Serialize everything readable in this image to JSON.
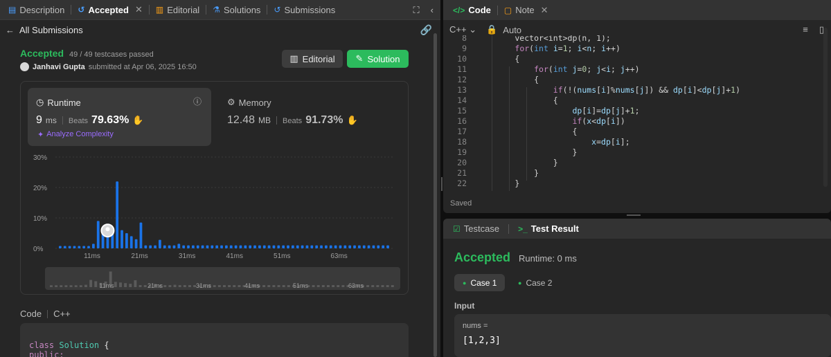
{
  "left_tabs": [
    {
      "label": "Description",
      "icon": "document-icon"
    },
    {
      "label": "Accepted",
      "icon": "history-icon"
    },
    {
      "label": "Editorial",
      "icon": "book-icon"
    },
    {
      "label": "Solutions",
      "icon": "flask-icon"
    },
    {
      "label": "Submissions",
      "icon": "history-icon"
    }
  ],
  "subheader": {
    "back_label": "All Submissions"
  },
  "submission": {
    "status": "Accepted",
    "testcases": "49 / 49 testcases passed",
    "author": "Janhavi Gupta",
    "submitted_text": "submitted at Apr 06, 2025 16:50",
    "editorial_btn": "Editorial",
    "solution_btn": "Solution"
  },
  "runtime": {
    "title": "Runtime",
    "value": "9",
    "unit": "ms",
    "beats_label": "Beats",
    "beats_pct": "79.63%",
    "analyze": "Analyze Complexity"
  },
  "memory": {
    "title": "Memory",
    "value": "12.48",
    "unit": "MB",
    "beats_label": "Beats",
    "beats_pct": "91.73%"
  },
  "chart_data": {
    "type": "bar",
    "yticks": [
      "30%",
      "20%",
      "10%",
      "0%"
    ],
    "ylim": [
      0,
      30
    ],
    "xticks": [
      "11ms",
      "21ms",
      "31ms",
      "41ms",
      "51ms",
      "63ms"
    ],
    "values": [
      0.8,
      0.8,
      0.8,
      0.8,
      0.8,
      0.8,
      0.8,
      1.5,
      9.0,
      7.0,
      4.5,
      6.5,
      22.0,
      6.0,
      5.0,
      4.0,
      3.0,
      8.5,
      1.0,
      1.0,
      1.0,
      2.8,
      1.0,
      1.0,
      1.0,
      1.5,
      1.0,
      1.0,
      1.0,
      1.0,
      1.0,
      1.0,
      1.0,
      1.0,
      1.0,
      1.0,
      1.0,
      1.0,
      1.0,
      1.0,
      1.0,
      1.0,
      1.0,
      1.0,
      1.0,
      1.0,
      1.0,
      1.0,
      1.0,
      1.0,
      1.0,
      1.0,
      1.0,
      1.0,
      1.0,
      1.0,
      1.0,
      1.0,
      1.0,
      1.0,
      1.0,
      1.0,
      1.0,
      1.0,
      1.0,
      1.0,
      1.0,
      1.0,
      1.0,
      1.0
    ],
    "highlight_index": 10,
    "bar_color": "#1a73e8",
    "overview_color": "#5a5a5a"
  },
  "code_section": {
    "label": "Code",
    "lang": "C++",
    "line1_kw": "class",
    "line1_name": "Solution",
    "line1_brace": "{",
    "line2": "public:"
  },
  "right_tabs": {
    "code": "Code",
    "note": "Note"
  },
  "editor": {
    "language": "C++",
    "mode": "Auto",
    "saved": "Saved",
    "lines": [
      {
        "n": "8",
        "html": "        vector&lt;int&gt;dp(n, 1);"
      },
      {
        "n": "9",
        "html": "        <span class='c-kw'>for</span>(<span class='c-ty'>int</span> <span class='c-var'>i</span>=<span class='c-num'>1</span>; <span class='c-var'>i</span>&lt;<span class='c-var'>n</span>; <span class='c-var'>i</span>++)"
      },
      {
        "n": "10",
        "html": "        {"
      },
      {
        "n": "11",
        "html": "            <span class='c-kw'>for</span>(<span class='c-ty'>int</span> <span class='c-var'>j</span>=<span class='c-num'>0</span>; <span class='c-var'>j</span>&lt;<span class='c-var'>i</span>; <span class='c-var'>j</span>++)"
      },
      {
        "n": "12",
        "html": "            {"
      },
      {
        "n": "13",
        "html": "                <span class='c-kw'>if</span>(!(<span class='c-var'>nums</span>[<span class='c-var'>i</span>]%<span class='c-var'>nums</span>[<span class='c-var'>j</span>]) &amp;&amp; <span class='c-var'>dp</span>[<span class='c-var'>i</span>]&lt;<span class='c-var'>dp</span>[<span class='c-var'>j</span>]+<span class='c-num'>1</span>)"
      },
      {
        "n": "14",
        "html": "                {"
      },
      {
        "n": "15",
        "html": "                    <span class='c-var'>dp</span>[<span class='c-var'>i</span>]=<span class='c-var'>dp</span>[<span class='c-var'>j</span>]+<span class='c-num'>1</span>;"
      },
      {
        "n": "16",
        "html": "                    <span class='c-kw'>if</span>(<span class='c-var'>x</span>&lt;<span class='c-var'>dp</span>[<span class='c-var'>i</span>])"
      },
      {
        "n": "17",
        "html": "                    {"
      },
      {
        "n": "18",
        "html": "                        <span class='c-var'>x</span>=<span class='c-var'>dp</span>[<span class='c-var'>i</span>];"
      },
      {
        "n": "19",
        "html": "                    }"
      },
      {
        "n": "20",
        "html": "                }"
      },
      {
        "n": "21",
        "html": "            }"
      },
      {
        "n": "22",
        "html": "        }"
      }
    ]
  },
  "result": {
    "testcase_tab": "Testcase",
    "result_tab": "Test Result",
    "status": "Accepted",
    "runtime": "Runtime: 0 ms",
    "case1": "Case 1",
    "case2": "Case 2",
    "input_label": "Input",
    "var_name": "nums =",
    "var_value": "[1,2,3]"
  }
}
